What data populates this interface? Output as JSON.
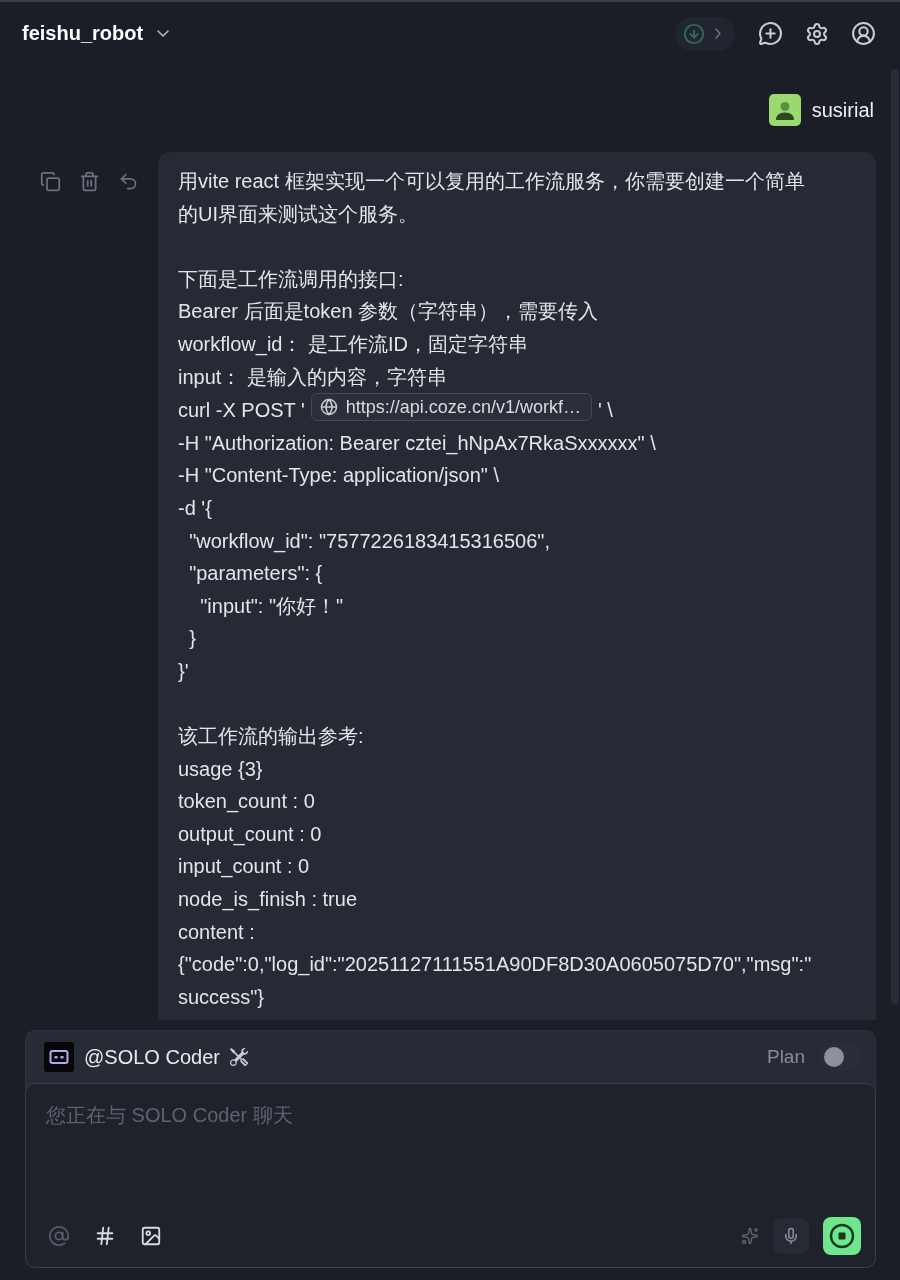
{
  "header": {
    "title": "feishu_robot"
  },
  "user": {
    "name": "susirial"
  },
  "message": {
    "paragraphs": [
      {
        "lines": [
          {
            "kind": "text",
            "text": "用vite react 框架实现一个可以复用的工作流服务，你需要创建一个简单的UI界面来测试这个服务。"
          }
        ]
      },
      {
        "lines": [
          {
            "kind": "text",
            "text": "下面是工作流调用的接口:"
          },
          {
            "kind": "text",
            "text": "Bearer 后面是token 参数（字符串），需要传入"
          },
          {
            "kind": "text",
            "text": "workflow_id： 是工作流ID，固定字符串"
          },
          {
            "kind": "text",
            "text": "input： 是输入的内容，字符串"
          },
          {
            "kind": "link",
            "before": "curl -X POST '",
            "link": "https://api.coze.cn/v1/workf…",
            "after": "' \\"
          },
          {
            "kind": "text",
            "text": "-H \"Authorization: Bearer cztei_hNpAx7RkaSxxxxxx\" \\"
          },
          {
            "kind": "text",
            "text": "-H \"Content-Type: application/json\" \\"
          },
          {
            "kind": "text",
            "text": "-d '{"
          },
          {
            "kind": "text",
            "text": "  \"workflow_id\": \"7577226183415316506\","
          },
          {
            "kind": "text",
            "text": "  \"parameters\": {"
          },
          {
            "kind": "text",
            "text": "    \"input\": \"你好！\""
          },
          {
            "kind": "text",
            "text": "  }"
          },
          {
            "kind": "text",
            "text": "}'"
          }
        ]
      },
      {
        "lines": [
          {
            "kind": "text",
            "text": "该工作流的输出参考:"
          },
          {
            "kind": "text",
            "text": "usage {3}"
          },
          {
            "kind": "text",
            "text": "token_count : 0"
          },
          {
            "kind": "text",
            "text": "output_count : 0"
          },
          {
            "kind": "text",
            "text": "input_count : 0"
          },
          {
            "kind": "text",
            "text": "node_is_finish : true"
          },
          {
            "kind": "text",
            "text": "content :"
          },
          {
            "kind": "text",
            "text": "{\"code\":0,\"log_id\":\"20251127111551A90DF8D30A0605075D70\",\"msg\":\"success\"}"
          }
        ]
      }
    ]
  },
  "composer": {
    "agent": "@SOLO Coder",
    "plan": {
      "label": "Plan",
      "on": false
    },
    "placeholder": "您正在与 SOLO Coder 聊天",
    "tools": [
      {
        "kind": "mention",
        "disabled": true
      },
      {
        "kind": "hash",
        "disabled": false
      },
      {
        "kind": "image",
        "disabled": false
      }
    ]
  }
}
